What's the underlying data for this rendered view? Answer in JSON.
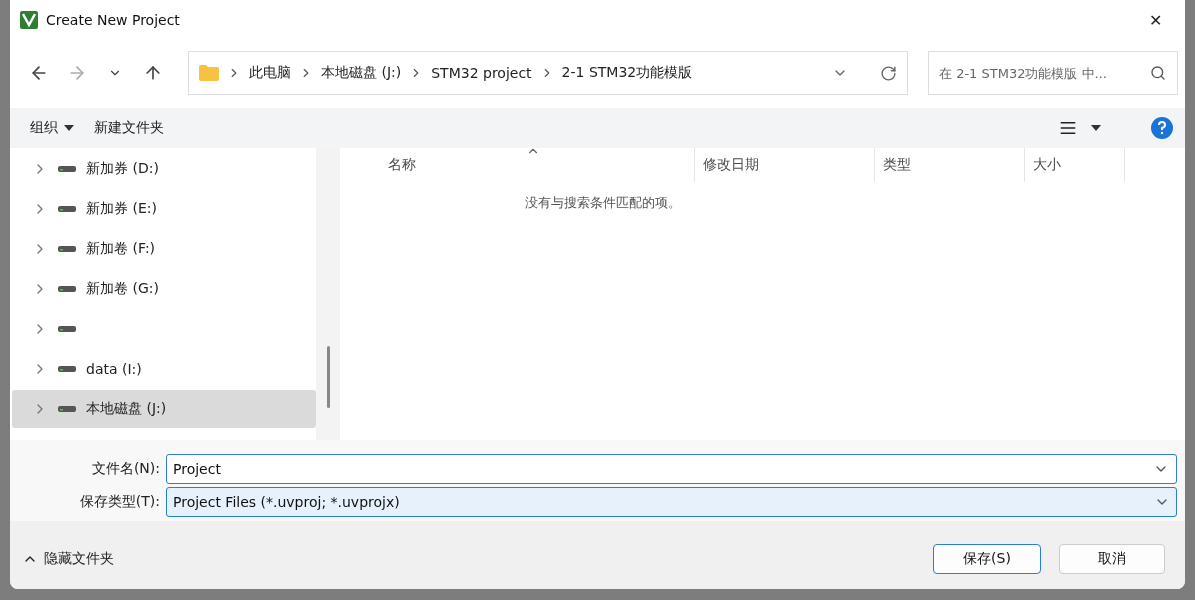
{
  "window": {
    "title": "Create New Project",
    "close": "✕"
  },
  "address": {
    "crumbs": [
      "此电脑",
      "本地磁盘 (J:)",
      "STM32 project",
      "2-1 STM32功能模版"
    ]
  },
  "search": {
    "placeholder": "在 2-1 STM32功能模版 中..."
  },
  "toolbar": {
    "organize": "组织",
    "new_folder": "新建文件夹"
  },
  "sidebar": {
    "items": [
      {
        "label": "新加券 (D:)",
        "selected": false
      },
      {
        "label": "新加券 (E:)",
        "selected": false
      },
      {
        "label": "新加卷 (F:)",
        "selected": false
      },
      {
        "label": "新加卷 (G:)",
        "selected": false
      },
      {
        "selected": false
      },
      {
        "label": "data (I:)",
        "selected": false
      },
      {
        "label": "本地磁盘 (J:)",
        "selected": true
      }
    ]
  },
  "table": {
    "columns": [
      {
        "label": "名称",
        "sorted": true
      },
      {
        "label": "修改日期",
        "sorted": false
      },
      {
        "label": "类型",
        "sorted": false
      },
      {
        "label": "大小",
        "sorted": false
      }
    ],
    "empty_message": "没有与搜索条件匹配的项。"
  },
  "file_name": {
    "label": "文件名(N):",
    "value": "Project"
  },
  "file_type": {
    "label": "保存类型(T):",
    "value": "Project Files (*.uvproj; *.uvprojx)"
  },
  "hide_folders": "隐藏文件夹",
  "buttons": [
    {
      "label": "保存(S)",
      "primary": true
    },
    {
      "label": "取消",
      "primary": false
    }
  ]
}
